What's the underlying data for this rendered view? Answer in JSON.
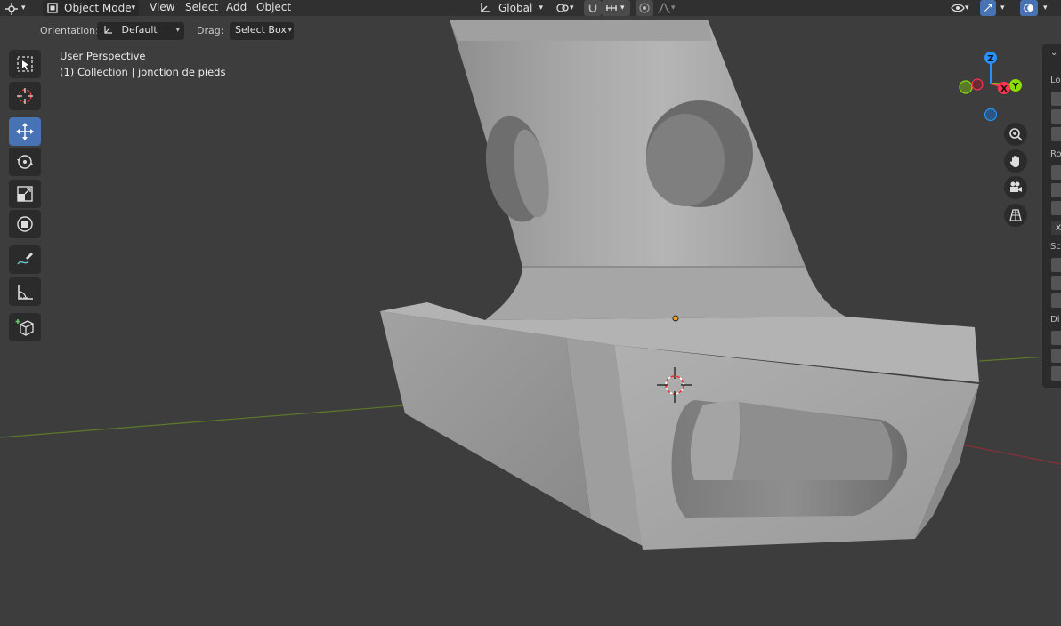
{
  "header": {
    "mode_label": "Object Mode",
    "menus": [
      "View",
      "Select",
      "Add",
      "Object"
    ],
    "transform_orientation": "Global"
  },
  "tool_settings": {
    "orientation_label": "Orientation:",
    "orientation_value": "Default",
    "drag_label": "Drag:",
    "drag_value": "Select Box"
  },
  "viewport": {
    "view_name": "User Perspective",
    "object_info": "(1) Collection | jonction de pieds",
    "gizmo_axes": {
      "z": "Z",
      "y": "Y",
      "x": "X"
    }
  },
  "sidebar": {
    "section_labels": [
      "Lo",
      "Ro",
      "Sc",
      "Di"
    ],
    "rotation_mode_glyph": "X"
  },
  "toolbar": {
    "tools": [
      "select-box",
      "cursor",
      "move",
      "rotate",
      "scale",
      "transform",
      "annotate",
      "measure",
      "add-cube"
    ],
    "active_tool": "move"
  },
  "colors": {
    "accent": "#4772b3",
    "axis_x": "#ff3352",
    "axis_y": "#8bdc00",
    "axis_z": "#2890ff",
    "viewport_bg": "#3d3d3d"
  }
}
